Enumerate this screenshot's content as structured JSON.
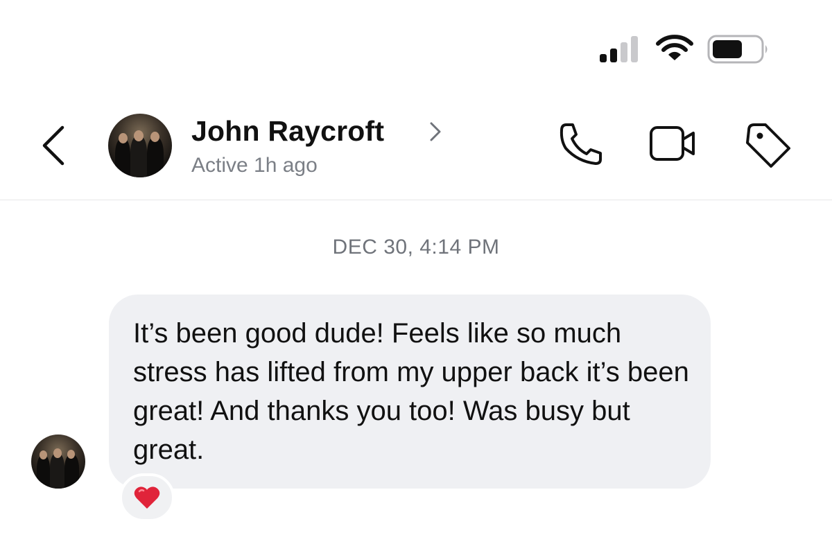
{
  "status_bar": {
    "signal_icon": "cellular-signal-icon",
    "signal_bars_active": 2,
    "signal_bars_total": 4,
    "wifi_icon": "wifi-icon",
    "battery_icon": "battery-icon",
    "battery_level": 0.6
  },
  "header": {
    "back_icon": "chevron-left-icon",
    "contact_name": "John Raycroft",
    "contact_chevron_icon": "chevron-right-icon",
    "active_status": "Active 1h ago",
    "actions": [
      "phone-icon",
      "video-camera-icon",
      "tag-icon"
    ]
  },
  "conversation": {
    "timestamp": "DEC 30, 4:14 PM",
    "messages": [
      {
        "text": "It’s been good dude! Feels like so much stress has lifted from my upper back it’s been great! And thanks you too! Was busy but great.",
        "reaction": "❤️"
      }
    ]
  },
  "colors": {
    "background": "#ffffff",
    "bubble": "#eff0f3",
    "secondary_text": "#7b7f86",
    "heart": "#e0243a"
  }
}
